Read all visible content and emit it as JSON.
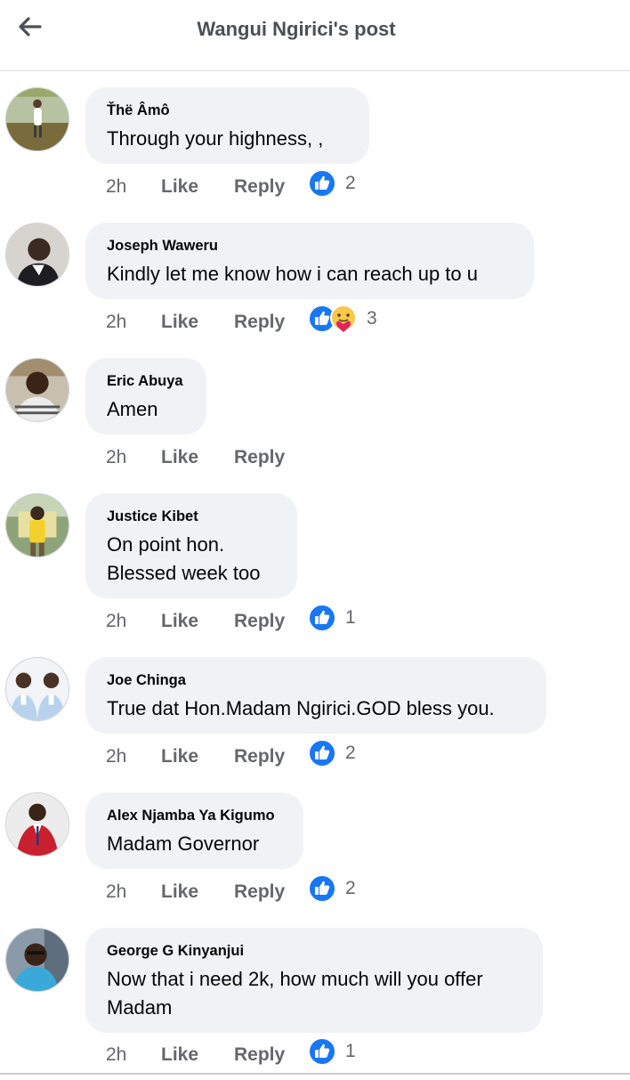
{
  "header": {
    "title": "Wangui Ngirici's post"
  },
  "actions": {
    "like_label": "Like",
    "reply_label": "Reply"
  },
  "colors": {
    "like_blue": "#1877f2",
    "bubble_bg": "#f0f2f5",
    "meta_gray": "#65676b"
  },
  "comments": [
    {
      "author": "Ťhë Âmô",
      "text": "Through your highness, ,",
      "time": "2h",
      "reactions": [
        "like-icon"
      ],
      "reaction_count": "2"
    },
    {
      "author": "Joseph Waweru",
      "text": "Kindly let me know how i can reach up to u",
      "time": "2h",
      "reactions": [
        "like-icon",
        "care-icon"
      ],
      "reaction_count": "3"
    },
    {
      "author": "Eric Abuya",
      "text": "Amen",
      "time": "2h",
      "reactions": [],
      "reaction_count": ""
    },
    {
      "author": "Justice Kibet",
      "text": "On point hon.\nBlessed week too",
      "time": "2h",
      "reactions": [
        "like-icon"
      ],
      "reaction_count": "1"
    },
    {
      "author": "Joe Chinga",
      "text": "True dat Hon.Madam Ngirici.GOD bless you.",
      "time": "2h",
      "reactions": [
        "like-icon"
      ],
      "reaction_count": "2"
    },
    {
      "author": "Alex Njamba Ya Kigumo",
      "text": "Madam Governor",
      "time": "2h",
      "reactions": [
        "like-icon"
      ],
      "reaction_count": "2"
    },
    {
      "author": "George G Kinyanjui",
      "text": "Now that i need 2k, how much will you offer\nMadam",
      "time": "2h",
      "reactions": [
        "like-icon"
      ],
      "reaction_count": "1"
    }
  ]
}
